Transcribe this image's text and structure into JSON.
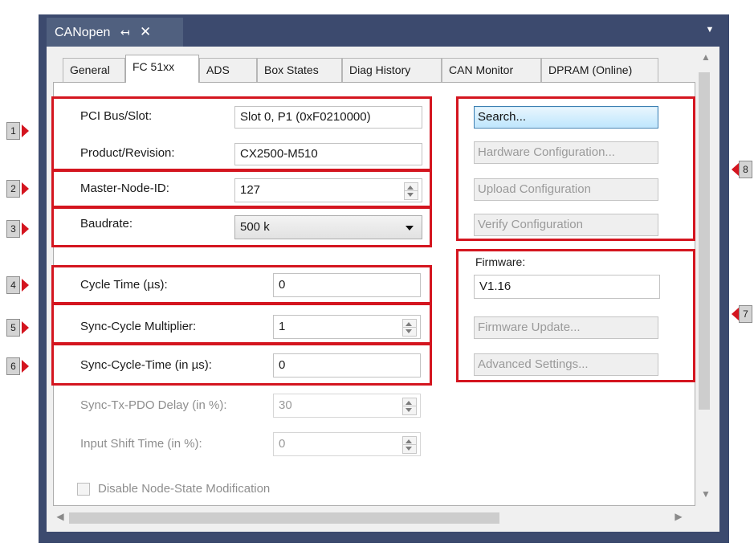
{
  "window": {
    "title": "CANopen",
    "pin_glyph": "↤",
    "close_glyph": "✕",
    "menu_glyph": "▼"
  },
  "tabs": [
    {
      "label": "General"
    },
    {
      "label": "FC 51xx",
      "active": true
    },
    {
      "label": "ADS"
    },
    {
      "label": "Box States"
    },
    {
      "label": "Diag History"
    },
    {
      "label": "CAN Monitor"
    },
    {
      "label": "DPRAM (Online)"
    }
  ],
  "left": {
    "pci_bus_slot": {
      "label": "PCI Bus/Slot:",
      "value": "Slot 0, P1 (0xF0210000)"
    },
    "product_revision": {
      "label": "Product/Revision:",
      "value": "CX2500-M510"
    },
    "master_node_id": {
      "label": "Master-Node-ID:",
      "value": "127"
    },
    "baudrate": {
      "label": "Baudrate:",
      "value": "500 k"
    },
    "cycle_time": {
      "label": "Cycle Time (µs):",
      "value": "0"
    },
    "sync_cycle_multiplier": {
      "label": "Sync-Cycle Multiplier:",
      "value": "1"
    },
    "sync_cycle_time": {
      "label": "Sync-Cycle-Time (in µs):",
      "value": "0"
    },
    "sync_tx_pdo_delay": {
      "label": "Sync-Tx-PDO Delay (in %):",
      "value": "30",
      "enabled": false
    },
    "input_shift_time": {
      "label": "Input Shift Time (in %):",
      "value": "0",
      "enabled": false
    },
    "disable_node_state": {
      "label": "Disable Node-State Modification",
      "checked": false,
      "enabled": false
    }
  },
  "right": {
    "buttons": {
      "search": "Search...",
      "hardware_config": "Hardware Configuration...",
      "upload_config": "Upload Configuration",
      "verify_config": "Verify Configuration"
    },
    "firmware": {
      "label": "Firmware:",
      "version": "V1.16",
      "update_button": "Firmware Update...",
      "advanced_button": "Advanced Settings..."
    }
  },
  "callouts": [
    "1",
    "2",
    "3",
    "4",
    "5",
    "6",
    "7",
    "8"
  ],
  "colors": {
    "callout_red": "#d4151f",
    "titlebar": "#3c4a6e",
    "primary_button": "#bee6fd"
  }
}
